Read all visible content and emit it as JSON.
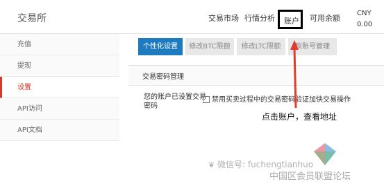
{
  "header": {
    "logo": "交易所",
    "nav": [
      "交易市场",
      "行情分析"
    ],
    "account": "账户",
    "balance_label": "可用余额",
    "currency": "CNY",
    "currency_value": "0.00"
  },
  "sidebar": {
    "items": [
      {
        "label": "充值",
        "active": false
      },
      {
        "label": "提现",
        "active": false
      },
      {
        "label": "设置",
        "active": true
      },
      {
        "label": "API访问",
        "active": false
      },
      {
        "label": "API文档",
        "active": false
      }
    ]
  },
  "tabs": [
    {
      "label": "个性化设置",
      "active": true
    },
    {
      "label": "修改BTC限额",
      "active": false
    },
    {
      "label": "修改LTC限额",
      "active": false
    },
    {
      "label": "款账号管理",
      "active": false
    }
  ],
  "section": {
    "title": "交易密码管理",
    "description": "您的账户已设置交易密码",
    "checkbox_label": "禁用买卖过程中的交易密码验证加快交易操作"
  },
  "annotation": "点击账户，查看地址",
  "watermark": {
    "wechat": "微信号: fuchengtianhuo",
    "forum": "中国区会员联盟论坛"
  },
  "colors": {
    "active_tab": "#1f7bbf",
    "active_sidebar": "#d43a2a",
    "annotation_arrow": "#e23b2b"
  }
}
